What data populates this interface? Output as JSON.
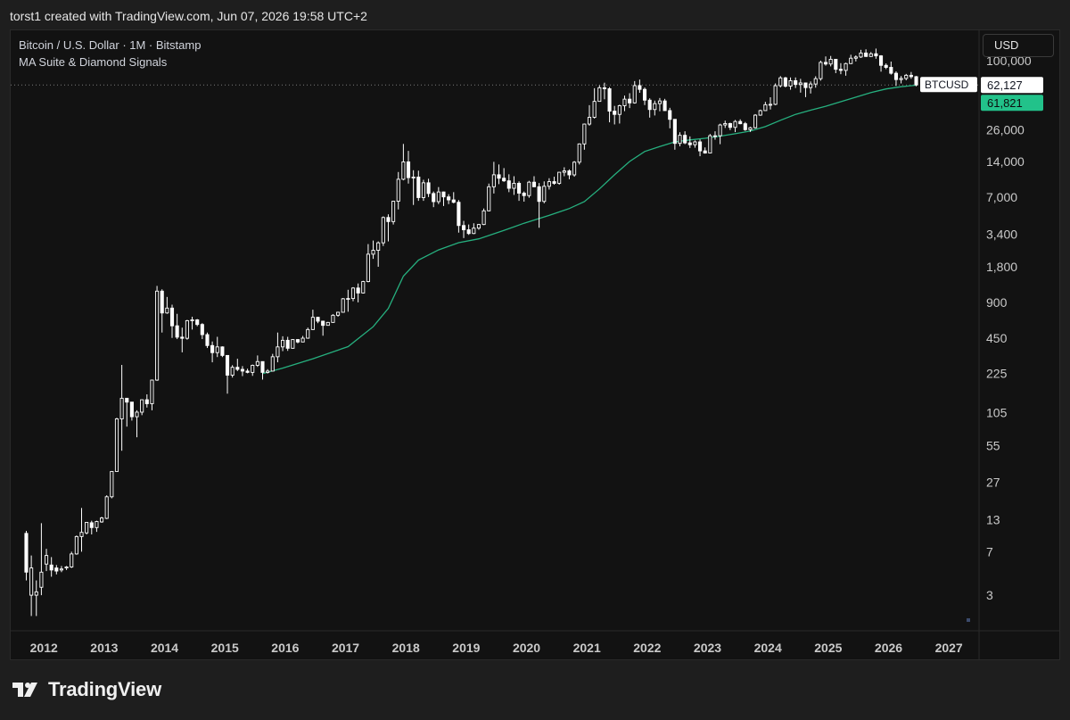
{
  "header": {
    "caption": "torst1 created with TradingView.com, Jun 07, 2026 19:58 UTC+2"
  },
  "legend": {
    "symbol_line": "Bitcoin / U.S. Dollar · 1M · Bitstamp",
    "indicator": "MA Suite & Diamond Signals"
  },
  "currency_button": "USD",
  "branding": {
    "text": "TradingView",
    "logo_icon": "tradingview-logo-icon"
  },
  "colors": {
    "background": "#121212",
    "candle": "#ffffff",
    "ma_line": "#26b07f",
    "ma_label_bg": "#22c28a",
    "price_label_bg": "#ffffff"
  },
  "chart_data": {
    "type": "candlestick",
    "scale": "log",
    "ylim": [
      1.5,
      180000
    ],
    "xlim": [
      2011.45,
      2027.5
    ],
    "y_ticks": [
      "100,000",
      "26,000",
      "14,000",
      "7,000",
      "3,400",
      "1,800",
      "900",
      "450",
      "225",
      "105",
      "55",
      "27",
      "13",
      "7",
      "3"
    ],
    "x_ticks": [
      "2012",
      "2013",
      "2014",
      "2015",
      "2016",
      "2017",
      "2018",
      "2019",
      "2020",
      "2021",
      "2022",
      "2023",
      "2024",
      "2025",
      "2026",
      "2027"
    ],
    "symbol_label": "BTCUSD",
    "last_price": 62127,
    "last_price_label": "62,127",
    "ma_value": 61821,
    "ma_value_label": "61,821",
    "candles": [
      [
        "2011-09",
        4.7,
        10.5,
        4.0,
        10.0
      ],
      [
        "2011-10",
        5.1,
        6.5,
        2.0,
        3.0
      ],
      [
        "2011-11",
        3.2,
        4.0,
        2.0,
        3.0
      ],
      [
        "2011-12",
        4.7,
        12.2,
        3.0,
        3.5
      ],
      [
        "2012-01",
        6.5,
        7.4,
        4.8,
        5.5
      ],
      [
        "2012-02",
        4.9,
        6.3,
        4.3,
        5.4
      ],
      [
        "2012-03",
        4.8,
        5.4,
        4.5,
        5.1
      ],
      [
        "2012-04",
        5.0,
        5.3,
        4.7,
        4.9
      ],
      [
        "2012-05",
        5.2,
        5.3,
        4.9,
        5.1
      ],
      [
        "2012-06",
        6.7,
        7.0,
        5.1,
        5.2
      ],
      [
        "2012-07",
        9.4,
        9.6,
        6.6,
        6.7
      ],
      [
        "2012-08",
        10.2,
        16.4,
        7.0,
        9.4
      ],
      [
        "2012-09",
        12.4,
        12.5,
        9.8,
        10.1
      ],
      [
        "2012-10",
        11.2,
        12.8,
        9.8,
        12.3
      ],
      [
        "2012-11",
        12.6,
        12.8,
        10.3,
        11.2
      ],
      [
        "2012-12",
        13.5,
        13.8,
        12.3,
        12.5
      ],
      [
        "2013-01",
        20.4,
        21.0,
        13.2,
        13.4
      ],
      [
        "2013-02",
        33.4,
        33.7,
        19.8,
        20.4
      ],
      [
        "2013-03",
        93.0,
        95.0,
        33.3,
        33.4
      ],
      [
        "2013-04",
        139,
        266,
        50,
        93
      ],
      [
        "2013-05",
        129,
        140,
        80,
        139
      ],
      [
        "2013-06",
        97,
        129,
        90,
        129
      ],
      [
        "2013-07",
        106,
        110,
        65,
        97
      ],
      [
        "2013-08",
        135,
        136,
        100,
        106
      ],
      [
        "2013-09",
        125,
        150,
        116,
        135
      ],
      [
        "2013-10",
        198,
        200,
        110,
        125
      ],
      [
        "2013-11",
        1120,
        1240,
        195,
        198
      ],
      [
        "2013-12",
        732,
        1160,
        500,
        1120
      ],
      [
        "2014-01",
        805,
        1000,
        720,
        732
      ],
      [
        "2014-02",
        570,
        860,
        450,
        805
      ],
      [
        "2014-03",
        457,
        720,
        440,
        570
      ],
      [
        "2014-04",
        447,
        550,
        340,
        457
      ],
      [
        "2014-05",
        630,
        640,
        435,
        447
      ],
      [
        "2014-06",
        640,
        680,
        530,
        630
      ],
      [
        "2014-07",
        585,
        650,
        565,
        640
      ],
      [
        "2014-08",
        480,
        600,
        440,
        585
      ],
      [
        "2014-09",
        388,
        500,
        370,
        480
      ],
      [
        "2014-10",
        338,
        420,
        280,
        388
      ],
      [
        "2014-11",
        378,
        460,
        310,
        338
      ],
      [
        "2014-12",
        320,
        382,
        310,
        378
      ],
      [
        "2015-01",
        218,
        320,
        152,
        320
      ],
      [
        "2015-02",
        254,
        265,
        208,
        218
      ],
      [
        "2015-03",
        244,
        300,
        236,
        254
      ],
      [
        "2015-04",
        236,
        260,
        214,
        244
      ],
      [
        "2015-05",
        230,
        247,
        226,
        236
      ],
      [
        "2015-06",
        264,
        268,
        215,
        230
      ],
      [
        "2015-07",
        284,
        320,
        256,
        264
      ],
      [
        "2015-08",
        230,
        285,
        200,
        284
      ],
      [
        "2015-09",
        236,
        245,
        225,
        230
      ],
      [
        "2015-10",
        312,
        330,
        235,
        236
      ],
      [
        "2015-11",
        378,
        500,
        280,
        312
      ],
      [
        "2015-12",
        430,
        465,
        348,
        378
      ],
      [
        "2016-01",
        368,
        460,
        350,
        430
      ],
      [
        "2016-02",
        436,
        440,
        365,
        368
      ],
      [
        "2016-03",
        416,
        440,
        405,
        436
      ],
      [
        "2016-04",
        448,
        468,
        415,
        416
      ],
      [
        "2016-05",
        530,
        550,
        443,
        448
      ],
      [
        "2016-06",
        673,
        780,
        525,
        530
      ],
      [
        "2016-07",
        624,
        680,
        600,
        673
      ],
      [
        "2016-08",
        575,
        630,
        470,
        624
      ],
      [
        "2016-09",
        609,
        615,
        575,
        575
      ],
      [
        "2016-10",
        700,
        715,
        605,
        609
      ],
      [
        "2016-11",
        742,
        750,
        680,
        700
      ],
      [
        "2016-12",
        965,
        980,
        740,
        742
      ],
      [
        "2017-01",
        970,
        1150,
        750,
        965
      ],
      [
        "2017-02",
        1190,
        1210,
        920,
        970
      ],
      [
        "2017-03",
        1080,
        1300,
        900,
        1190
      ],
      [
        "2017-04",
        1350,
        1370,
        1070,
        1080
      ],
      [
        "2017-05",
        2300,
        2800,
        1330,
        1350
      ],
      [
        "2017-06",
        2480,
        3000,
        2100,
        2300
      ],
      [
        "2017-07",
        2870,
        2950,
        1800,
        2480
      ],
      [
        "2017-08",
        4700,
        4800,
        2700,
        2870
      ],
      [
        "2017-09",
        4340,
        5000,
        2950,
        4700
      ],
      [
        "2017-10",
        6450,
        6500,
        4100,
        4340
      ],
      [
        "2017-11",
        9900,
        11400,
        5500,
        6450
      ],
      [
        "2017-12",
        13880,
        19700,
        9700,
        9900
      ],
      [
        "2018-01",
        10220,
        17200,
        9100,
        13880
      ],
      [
        "2018-02",
        10330,
        11800,
        6000,
        10220
      ],
      [
        "2018-03",
        6925,
        11700,
        6500,
        10330
      ],
      [
        "2018-04",
        9240,
        9800,
        6500,
        6925
      ],
      [
        "2018-05",
        7500,
        10000,
        7000,
        9240
      ],
      [
        "2018-06",
        6400,
        7800,
        5750,
        7500
      ],
      [
        "2018-07",
        7730,
        8500,
        6100,
        6400
      ],
      [
        "2018-08",
        7020,
        7780,
        5880,
        7730
      ],
      [
        "2018-09",
        6620,
        7400,
        6100,
        7020
      ],
      [
        "2018-10",
        6320,
        7700,
        6200,
        6620
      ],
      [
        "2018-11",
        4020,
        6600,
        3500,
        6320
      ],
      [
        "2018-12",
        3700,
        4400,
        3150,
        4020
      ],
      [
        "2019-01",
        3440,
        4100,
        3350,
        3700
      ],
      [
        "2019-02",
        3820,
        4200,
        3400,
        3440
      ],
      [
        "2019-03",
        4100,
        4150,
        3700,
        3820
      ],
      [
        "2019-04",
        5350,
        5600,
        4050,
        4100
      ],
      [
        "2019-05",
        8550,
        9100,
        5300,
        5350
      ],
      [
        "2019-06",
        10800,
        13900,
        7500,
        8550
      ],
      [
        "2019-07",
        10100,
        13200,
        9000,
        10800
      ],
      [
        "2019-08",
        9600,
        12300,
        9400,
        10100
      ],
      [
        "2019-09",
        8300,
        10900,
        7700,
        9600
      ],
      [
        "2019-10",
        9150,
        10500,
        7300,
        8300
      ],
      [
        "2019-11",
        7550,
        9500,
        6500,
        9150
      ],
      [
        "2019-12",
        7200,
        7800,
        6400,
        7550
      ],
      [
        "2020-01",
        9350,
        9600,
        6900,
        7200
      ],
      [
        "2020-02",
        8550,
        10500,
        8500,
        9350
      ],
      [
        "2020-03",
        6430,
        9200,
        3850,
        8550
      ],
      [
        "2020-04",
        8630,
        9500,
        6200,
        6430
      ],
      [
        "2020-05",
        9450,
        10100,
        8100,
        8630
      ],
      [
        "2020-06",
        9140,
        10400,
        8900,
        9450
      ],
      [
        "2020-07",
        11340,
        11400,
        8900,
        9140
      ],
      [
        "2020-08",
        11650,
        12500,
        10500,
        11340
      ],
      [
        "2020-09",
        10780,
        12000,
        9900,
        11650
      ],
      [
        "2020-10",
        13800,
        14100,
        10400,
        10780
      ],
      [
        "2020-11",
        19700,
        19900,
        13200,
        13800
      ],
      [
        "2020-12",
        29000,
        29300,
        17600,
        19700
      ],
      [
        "2021-01",
        33100,
        41900,
        28100,
        29000
      ],
      [
        "2021-02",
        45100,
        58300,
        32300,
        33100
      ],
      [
        "2021-03",
        58800,
        61700,
        45000,
        45100
      ],
      [
        "2021-04",
        57700,
        64900,
        47000,
        58800
      ],
      [
        "2021-05",
        37300,
        59500,
        30000,
        57700
      ],
      [
        "2021-06",
        35000,
        41300,
        28800,
        37300
      ],
      [
        "2021-07",
        41500,
        42300,
        29300,
        35000
      ],
      [
        "2021-08",
        47100,
        50500,
        37300,
        41500
      ],
      [
        "2021-09",
        43800,
        52900,
        39600,
        47100
      ],
      [
        "2021-10",
        61300,
        67000,
        43200,
        43800
      ],
      [
        "2021-11",
        57000,
        69000,
        53300,
        61300
      ],
      [
        "2021-12",
        46200,
        59100,
        42000,
        57000
      ],
      [
        "2022-01",
        38500,
        47900,
        32900,
        46200
      ],
      [
        "2022-02",
        43200,
        45800,
        34300,
        38500
      ],
      [
        "2022-03",
        45500,
        48200,
        37200,
        43200
      ],
      [
        "2022-04",
        37700,
        47400,
        37600,
        45500
      ],
      [
        "2022-05",
        31800,
        39800,
        26700,
        37700
      ],
      [
        "2022-06",
        19900,
        31900,
        17600,
        31800
      ],
      [
        "2022-07",
        23300,
        24700,
        18800,
        19900
      ],
      [
        "2022-08",
        20100,
        25200,
        19600,
        23300
      ],
      [
        "2022-09",
        19400,
        22800,
        18200,
        20100
      ],
      [
        "2022-10",
        20500,
        21100,
        18300,
        19400
      ],
      [
        "2022-11",
        17200,
        21500,
        15500,
        20500
      ],
      [
        "2022-12",
        16500,
        18400,
        16300,
        17200
      ],
      [
        "2023-01",
        23100,
        23900,
        16500,
        16500
      ],
      [
        "2023-02",
        23100,
        25200,
        21400,
        23100
      ],
      [
        "2023-03",
        28500,
        29200,
        19600,
        23100
      ],
      [
        "2023-04",
        29300,
        31000,
        26900,
        28500
      ],
      [
        "2023-05",
        27200,
        29800,
        25800,
        29300
      ],
      [
        "2023-06",
        30500,
        31400,
        24800,
        27200
      ],
      [
        "2023-07",
        29200,
        31800,
        28900,
        30500
      ],
      [
        "2023-08",
        26000,
        30200,
        25400,
        29200
      ],
      [
        "2023-09",
        27000,
        27500,
        24900,
        26000
      ],
      [
        "2023-10",
        34500,
        35200,
        26600,
        27000
      ],
      [
        "2023-11",
        37700,
        38400,
        34100,
        34500
      ],
      [
        "2023-12",
        42300,
        44700,
        37600,
        37700
      ],
      [
        "2024-01",
        42600,
        48900,
        38500,
        42300
      ],
      [
        "2024-02",
        61200,
        64000,
        41900,
        42600
      ],
      [
        "2024-03",
        71300,
        73800,
        59200,
        61200
      ],
      [
        "2024-04",
        60700,
        72700,
        59200,
        71300
      ],
      [
        "2024-05",
        67500,
        71900,
        56600,
        60700
      ],
      [
        "2024-06",
        62700,
        71900,
        58500,
        67500
      ],
      [
        "2024-07",
        64600,
        70000,
        53500,
        62700
      ],
      [
        "2024-08",
        59000,
        65100,
        49000,
        64600
      ],
      [
        "2024-09",
        63300,
        66500,
        52600,
        59000
      ],
      [
        "2024-10",
        70200,
        73600,
        58900,
        63300
      ],
      [
        "2024-11",
        96400,
        99800,
        67500,
        70200
      ],
      [
        "2024-12",
        93400,
        108300,
        90500,
        96400
      ],
      [
        "2025-01",
        102400,
        109300,
        89200,
        93400
      ],
      [
        "2025-02",
        84300,
        102500,
        78200,
        102400
      ],
      [
        "2025-03",
        82500,
        95000,
        76600,
        84300
      ],
      [
        "2025-04",
        94200,
        95800,
        74400,
        82500
      ],
      [
        "2025-05",
        104600,
        111900,
        93400,
        94200
      ],
      [
        "2025-06",
        107100,
        110500,
        98200,
        104600
      ],
      [
        "2025-07",
        115700,
        123200,
        105100,
        107100
      ],
      [
        "2025-08",
        108200,
        124400,
        107300,
        115700
      ],
      [
        "2025-09",
        114000,
        117900,
        107300,
        108200
      ],
      [
        "2025-10",
        109500,
        126200,
        103500,
        114000
      ],
      [
        "2025-11",
        91000,
        111000,
        80500,
        109500
      ],
      [
        "2025-12",
        87500,
        94500,
        84500,
        91000
      ],
      [
        "2026-01",
        78000,
        98000,
        76000,
        87500
      ],
      [
        "2026-02",
        69000,
        81000,
        61000,
        78000
      ],
      [
        "2026-03",
        70500,
        74000,
        64000,
        69000
      ],
      [
        "2026-04",
        75000,
        77000,
        68000,
        70500
      ],
      [
        "2026-05",
        73000,
        80000,
        70000,
        75000
      ],
      [
        "2026-06",
        62127,
        74000,
        60500,
        73000
      ]
    ],
    "ma_series": [
      [
        "2015-08",
        225
      ],
      [
        "2015-12",
        250
      ],
      [
        "2016-06",
        300
      ],
      [
        "2017-01",
        380
      ],
      [
        "2017-06",
        560
      ],
      [
        "2017-09",
        800
      ],
      [
        "2017-12",
        1500
      ],
      [
        "2018-03",
        2050
      ],
      [
        "2018-07",
        2500
      ],
      [
        "2018-11",
        2880
      ],
      [
        "2019-03",
        3100
      ],
      [
        "2019-08",
        3650
      ],
      [
        "2019-12",
        4200
      ],
      [
        "2020-05",
        4900
      ],
      [
        "2020-09",
        5600
      ],
      [
        "2020-12",
        6400
      ],
      [
        "2021-03",
        8200
      ],
      [
        "2021-06",
        10800
      ],
      [
        "2021-09",
        14000
      ],
      [
        "2021-12",
        17000
      ],
      [
        "2022-03",
        18700
      ],
      [
        "2022-06",
        20500
      ],
      [
        "2022-09",
        21300
      ],
      [
        "2022-12",
        22000
      ],
      [
        "2023-03",
        22900
      ],
      [
        "2023-06",
        24000
      ],
      [
        "2023-09",
        25300
      ],
      [
        "2023-12",
        27600
      ],
      [
        "2024-03",
        31200
      ],
      [
        "2024-06",
        35000
      ],
      [
        "2024-09",
        38000
      ],
      [
        "2024-12",
        41000
      ],
      [
        "2025-03",
        44800
      ],
      [
        "2025-06",
        49000
      ],
      [
        "2025-09",
        53500
      ],
      [
        "2025-12",
        57500
      ],
      [
        "2026-03",
        60000
      ],
      [
        "2026-06",
        61821
      ]
    ]
  }
}
